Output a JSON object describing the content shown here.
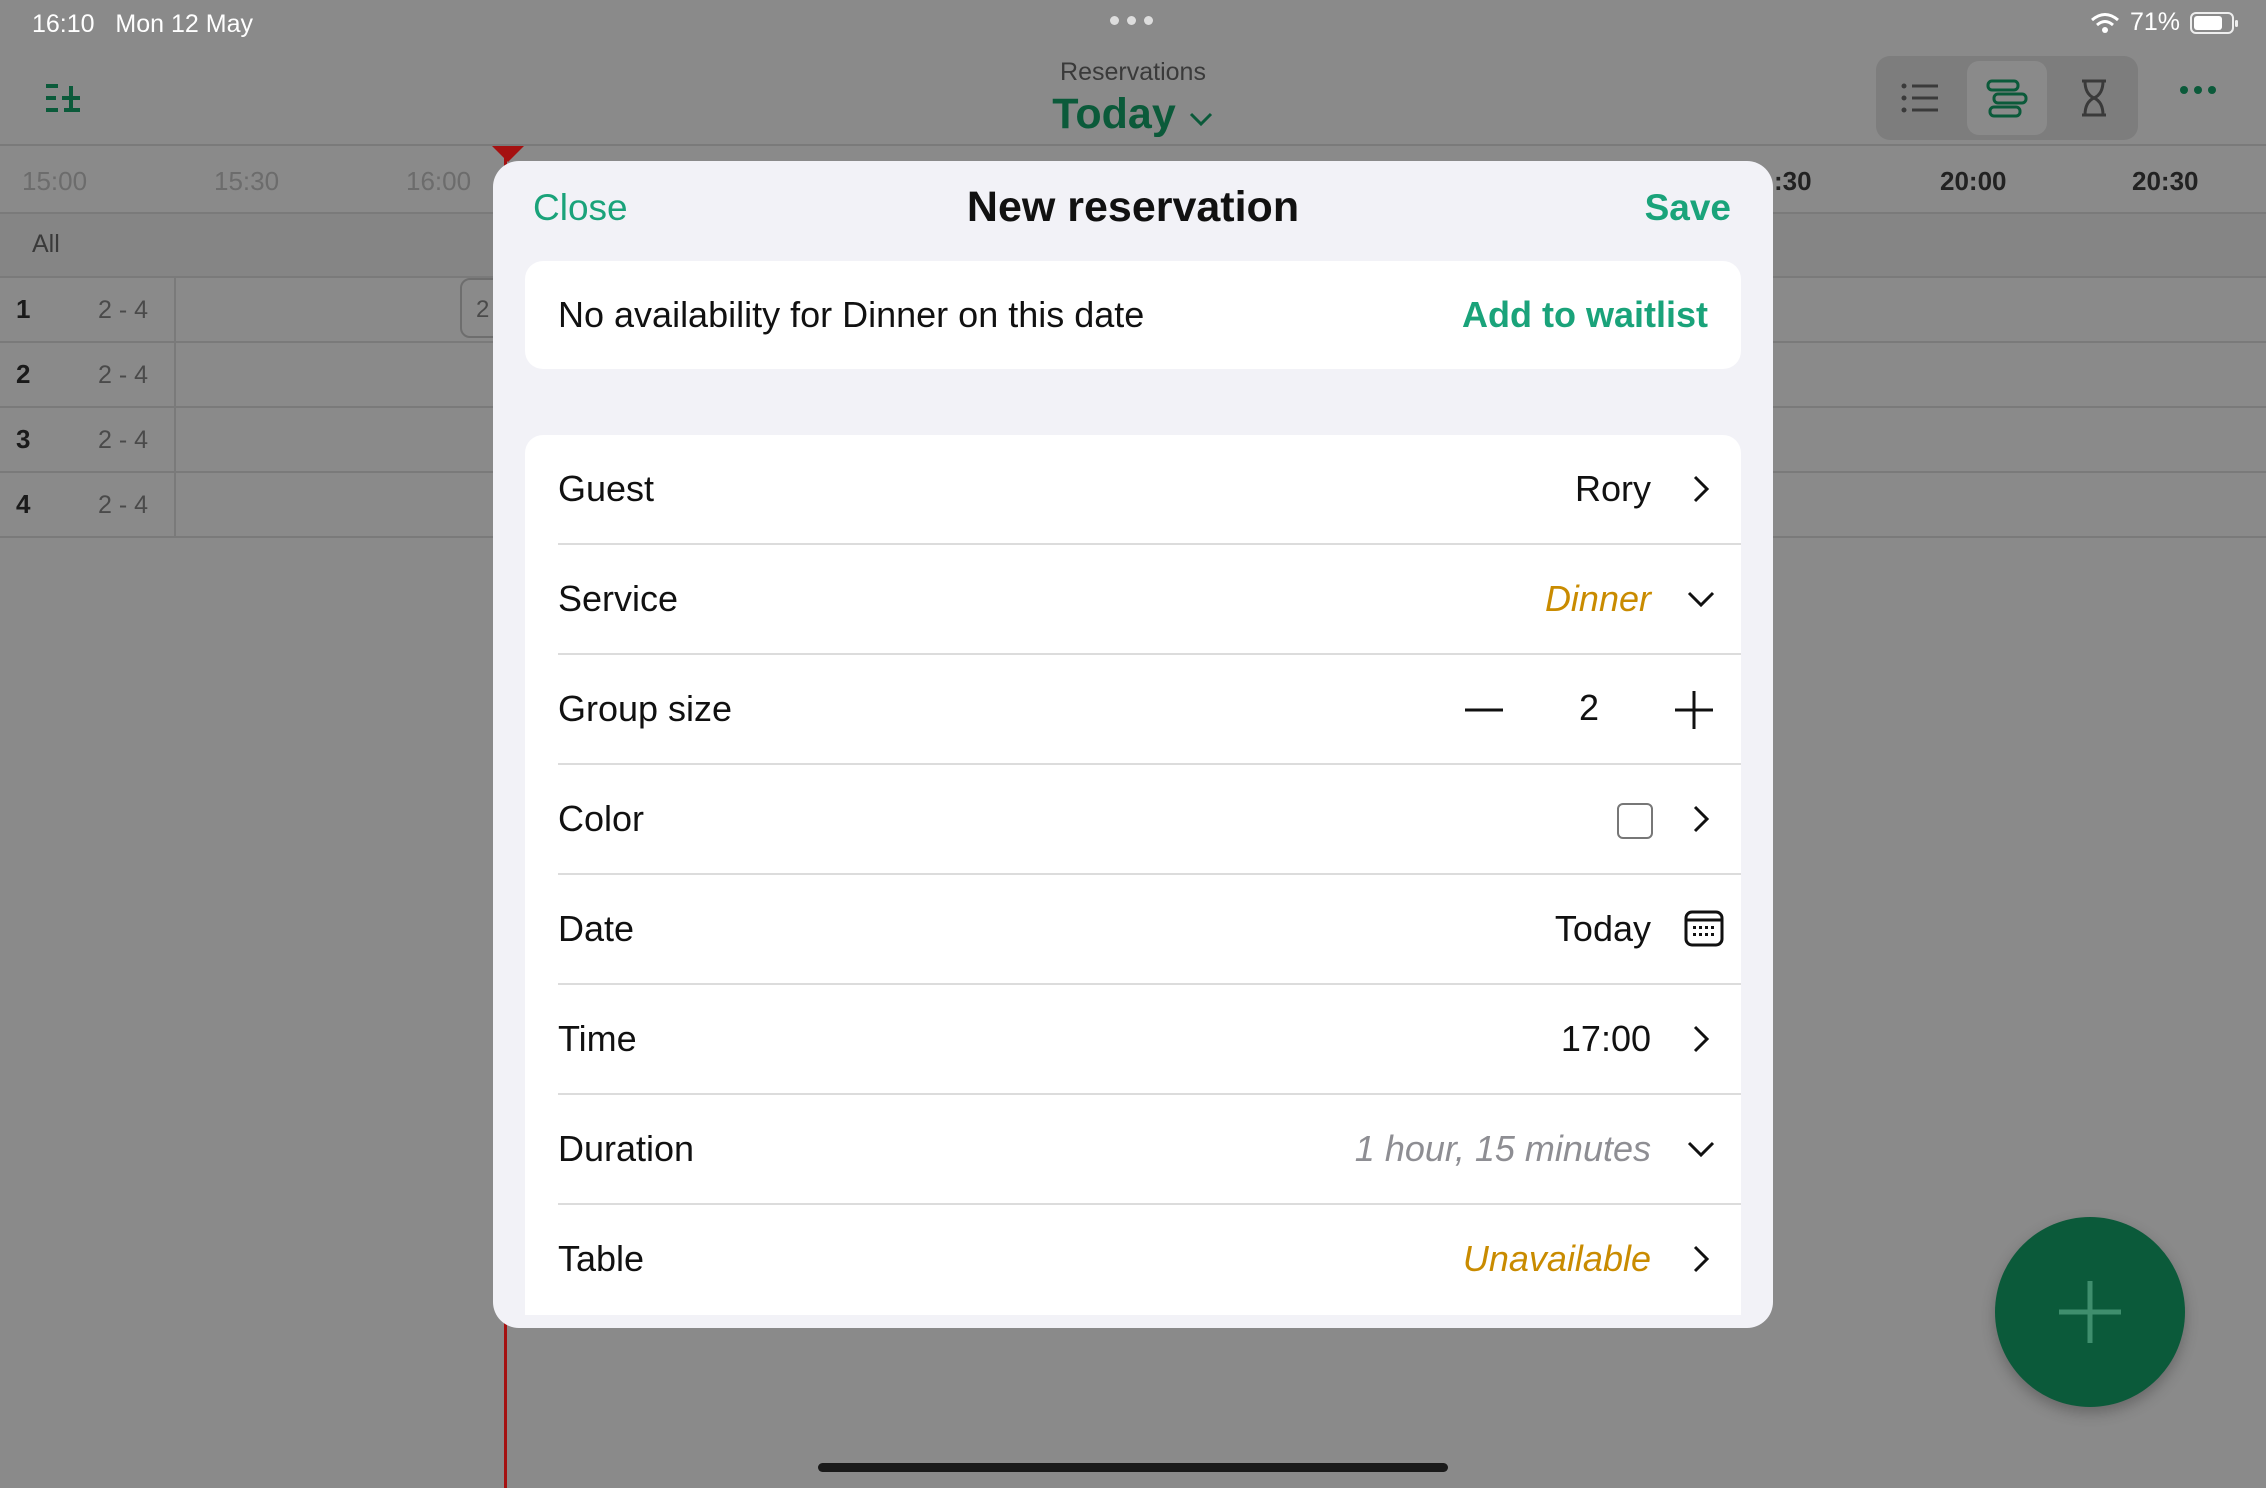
{
  "status_bar": {
    "time": "16:10",
    "date": "Mon 12 May",
    "battery": "71%",
    "battery_level": 0.71
  },
  "nav": {
    "subtitle": "Reservations",
    "title": "Today",
    "view_options": [
      "list-icon",
      "timeline-icon",
      "waitlist-hourglass-icon"
    ],
    "active_view": "timeline-icon"
  },
  "timeline": {
    "past_labels": [
      "15:00",
      "15:30",
      "16:00"
    ],
    "future_labels": [
      ":30",
      "20:00",
      "20:30"
    ],
    "all_label": "All",
    "chip_label": "2"
  },
  "tables": [
    {
      "number": "1",
      "capacity": "2 - 4"
    },
    {
      "number": "2",
      "capacity": "2 - 4"
    },
    {
      "number": "3",
      "capacity": "2 - 4"
    },
    {
      "number": "4",
      "capacity": "2 - 4"
    }
  ],
  "modal": {
    "close_label": "Close",
    "title": "New reservation",
    "save_label": "Save",
    "notice_text": "No availability for Dinner on this date",
    "notice_action": "Add to waitlist",
    "fields": {
      "guest": {
        "label": "Guest",
        "value": "Rory"
      },
      "service": {
        "label": "Service",
        "value": "Dinner"
      },
      "group_size": {
        "label": "Group size",
        "value": "2"
      },
      "color": {
        "label": "Color"
      },
      "date": {
        "label": "Date",
        "value": "Today"
      },
      "time": {
        "label": "Time",
        "value": "17:00"
      },
      "duration": {
        "label": "Duration",
        "value": "1 hour, 15 minutes"
      },
      "table": {
        "label": "Table",
        "value": "Unavailable"
      }
    }
  },
  "colors": {
    "brand_green": "#0b5a3a",
    "action_green": "#1aa37a",
    "warning_orange": "#c98b00",
    "now_red": "#a51111"
  }
}
